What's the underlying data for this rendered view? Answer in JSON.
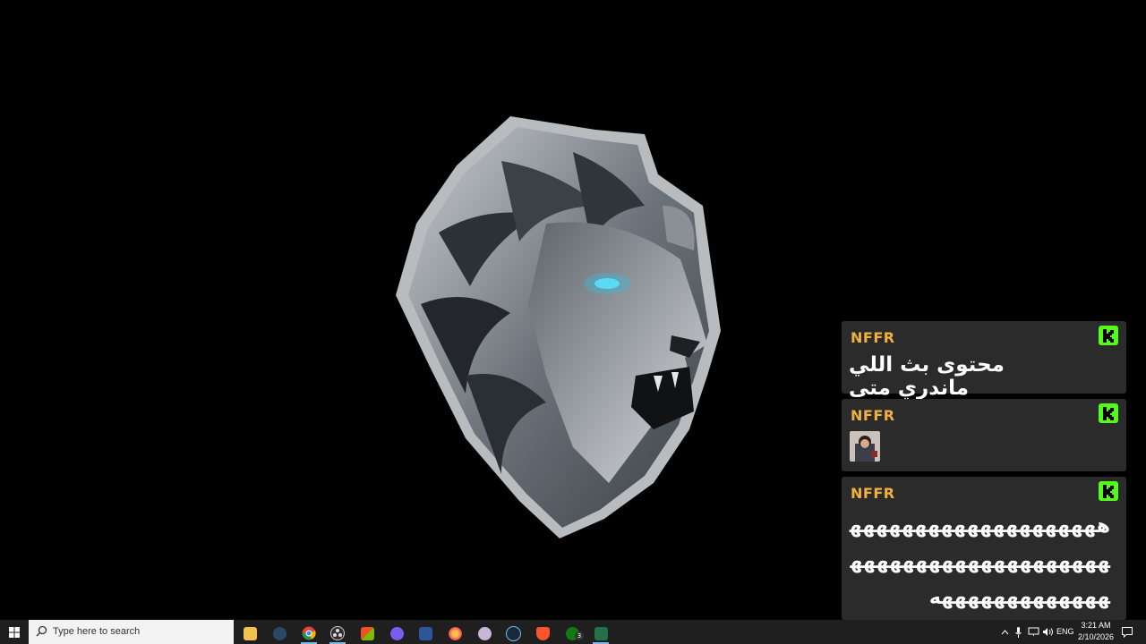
{
  "desktop": {
    "wallpaper": "lion-head-logo"
  },
  "chat": {
    "messages": [
      {
        "user": "NFFR",
        "text": "محتوى بث اللي ماندري متى",
        "badge": "kick-icon"
      },
      {
        "user": "NFFR",
        "text": "",
        "emote": "emote-image",
        "badge": "kick-icon"
      },
      {
        "user": "NFFR",
        "text": "هههههههههههههههههههههههههههههههههههههههههههههههههههههه",
        "badge": "kick-icon"
      }
    ],
    "colors": {
      "username": "#f0b13c",
      "card": "#2b2b2b",
      "badge": "#53fc18"
    }
  },
  "taskbar": {
    "search_placeholder": "Type here to search",
    "apps": [
      "file-explorer-icon",
      "discord-like-icon",
      "chrome-icon",
      "obs-icon",
      "store-icon",
      "messenger-icon",
      "word-icon",
      "firefox-icon",
      "app-icon",
      "steam-icon",
      "brave-icon",
      "xbox-icon",
      "excel-icon"
    ],
    "xbox_badge": "3",
    "language": "ENG",
    "time": "3:21 AM",
    "date": "2/10/2026"
  }
}
